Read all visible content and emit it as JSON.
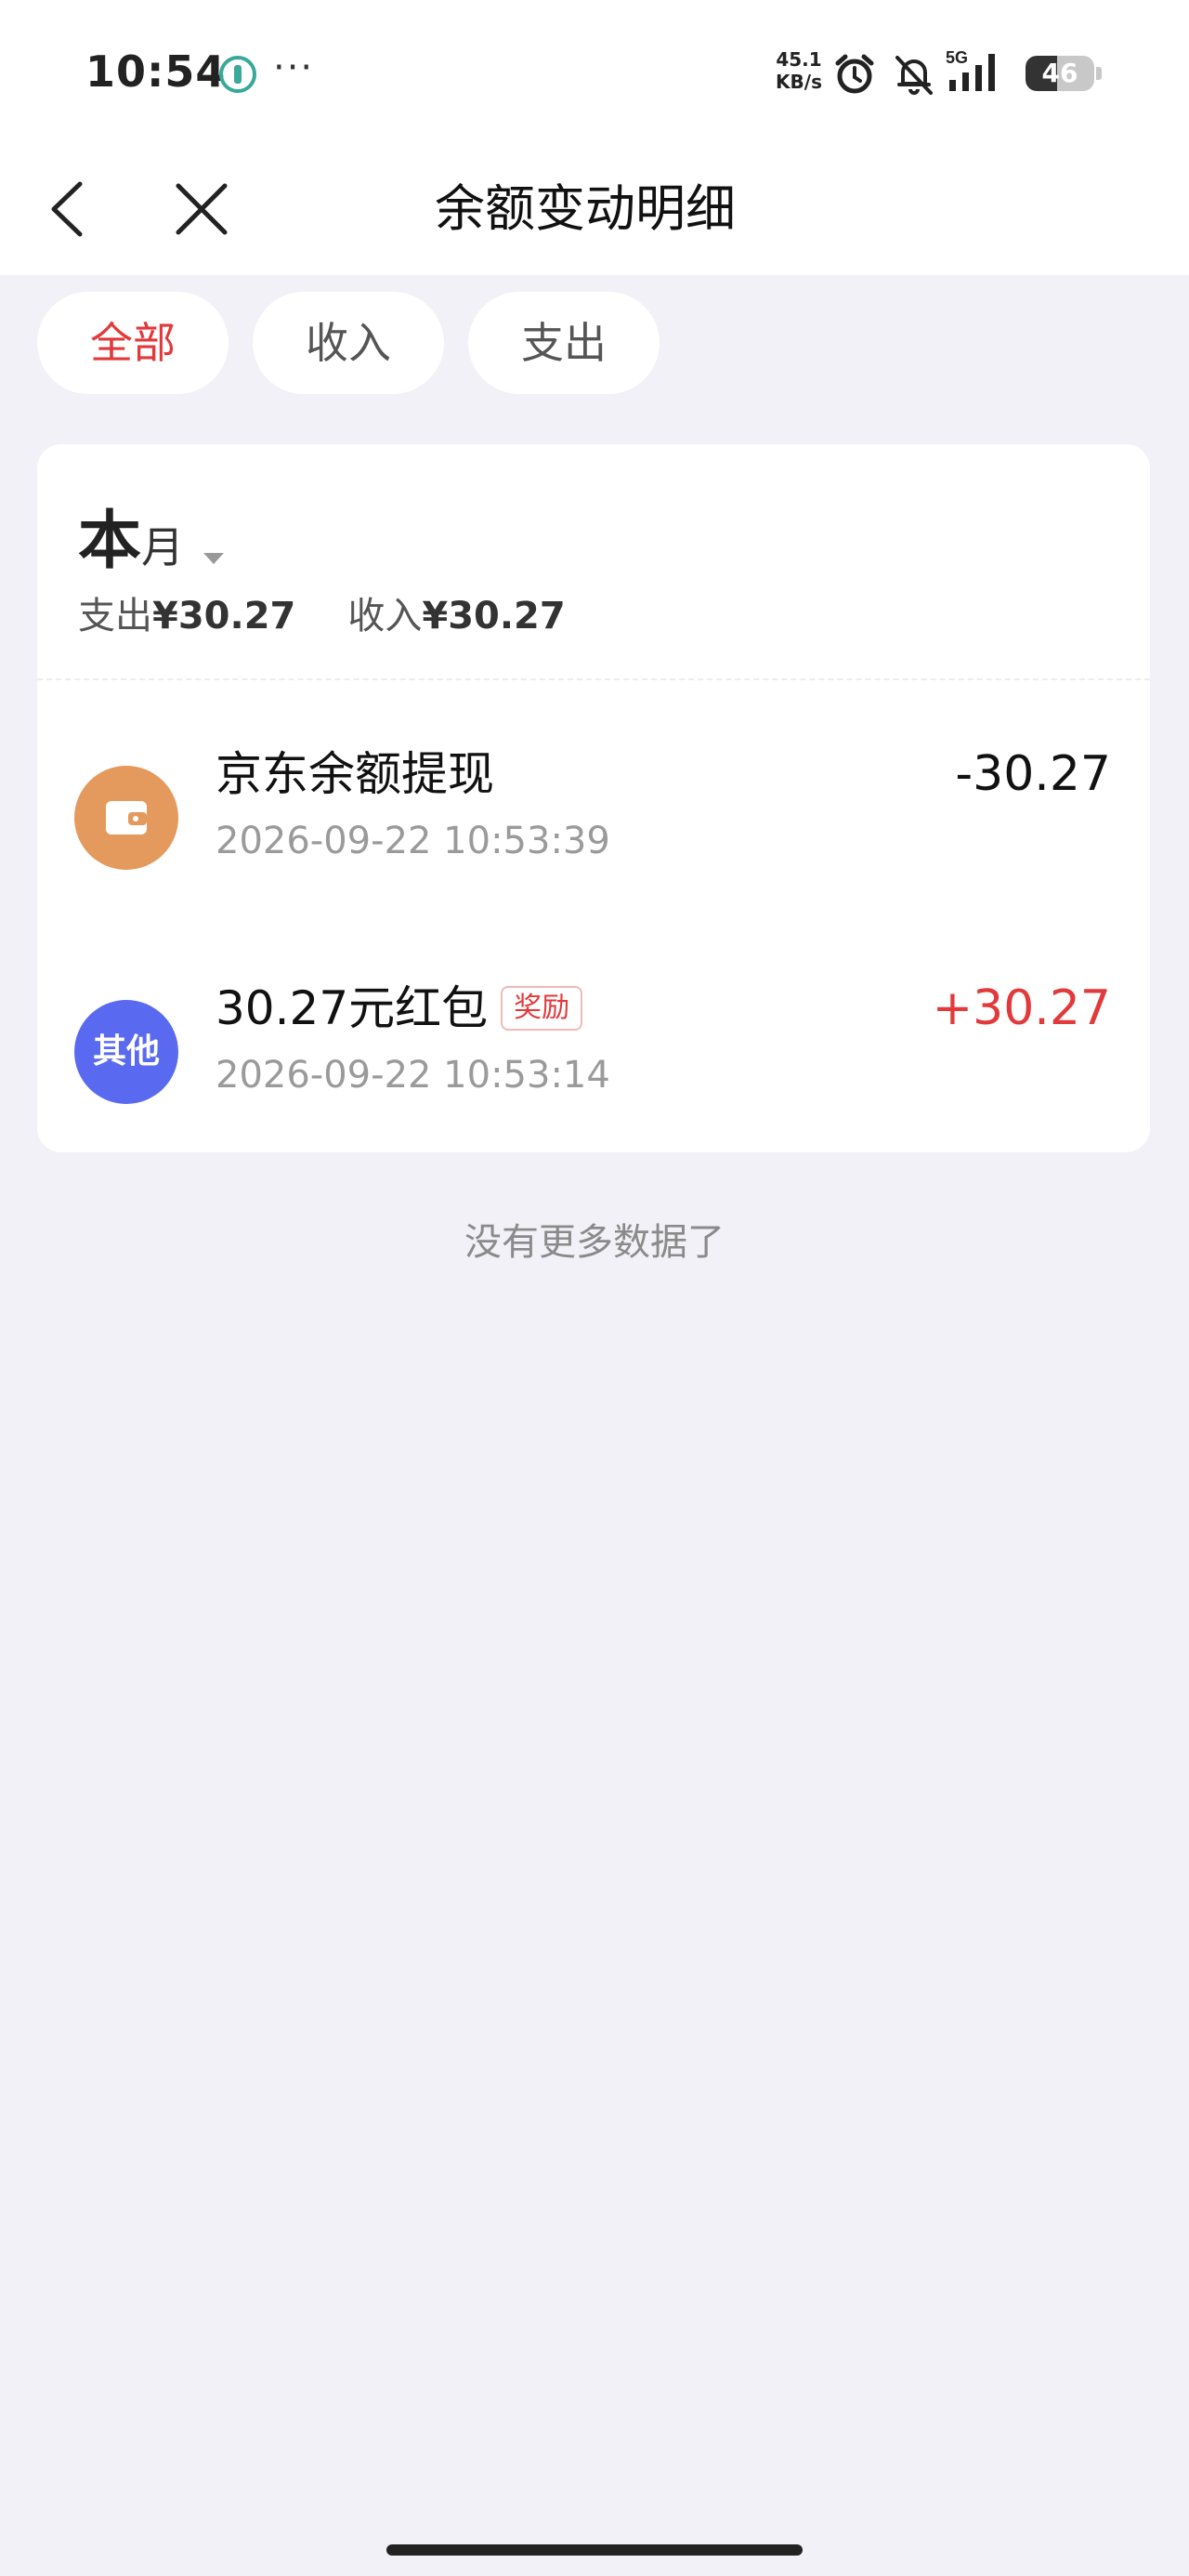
{
  "status_bar": {
    "time": "10:54",
    "dots": "···",
    "net_speed_value": "45.1",
    "net_speed_unit": "KB/s",
    "signal_label": "5G",
    "battery": "46",
    "battery_level": 0.46
  },
  "nav": {
    "title": "余额变动明细"
  },
  "filters": [
    {
      "label": "全部",
      "active": true
    },
    {
      "label": "收入",
      "active": false
    },
    {
      "label": "支出",
      "active": false
    }
  ],
  "period": {
    "big": "本",
    "small": "月"
  },
  "summary": {
    "expense_label": "支出",
    "expense_amount": "¥30.27",
    "income_label": "收入",
    "income_amount": "¥30.27"
  },
  "transactions": [
    {
      "icon": "wallet-icon",
      "title": "京东余额提现",
      "tag": "",
      "time": "2026-09-22 10:53:39",
      "amount": "-30.27"
    },
    {
      "icon": "other-icon",
      "icon_text": "其他",
      "title": "30.27元红包",
      "tag": "奖励",
      "time": "2026-09-22 10:53:14",
      "amount": "+30.27"
    }
  ],
  "footer": {
    "no_more": "没有更多数据了"
  },
  "colors": {
    "accent_red": "#e2393b",
    "page_bg": "#f1f1f7",
    "wallet_orange": "#e49a5c",
    "other_blue": "#5a6af0"
  }
}
